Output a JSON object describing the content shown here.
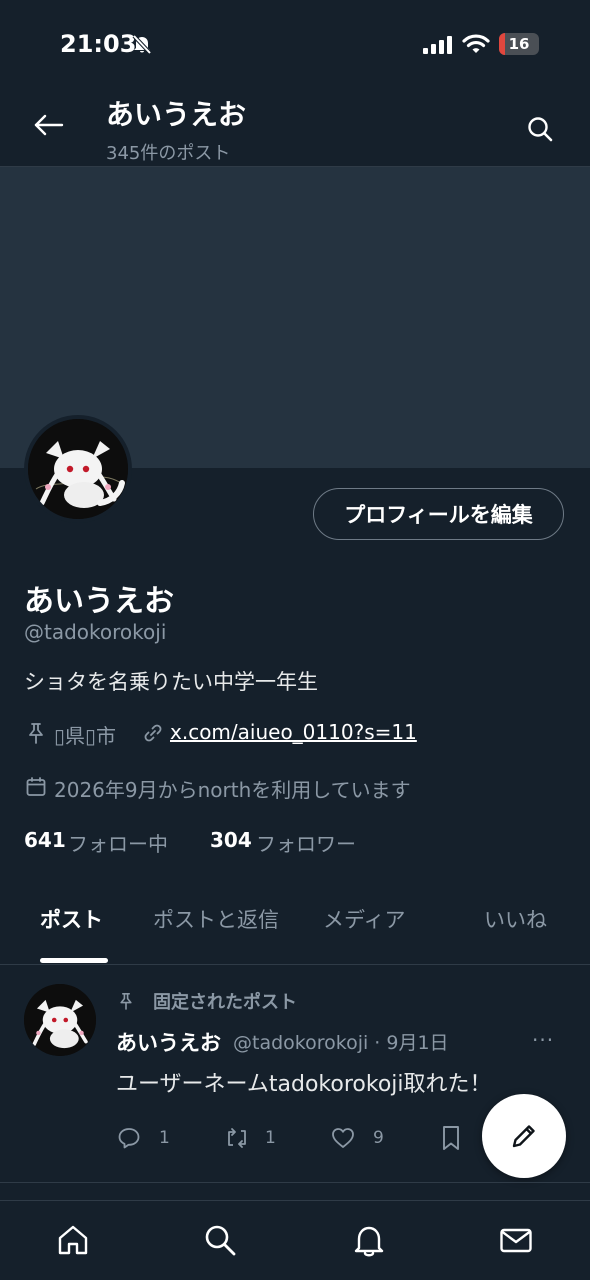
{
  "status_bar": {
    "time": "21:03",
    "battery": "16",
    "battery_level_pct": 16,
    "icons": [
      "bell-off-icon",
      "signal-icon",
      "wifi-icon",
      "battery-icon"
    ]
  },
  "header": {
    "title": "あいうえお",
    "post_count": "345件のポスト",
    "icons": [
      "back-arrow-icon",
      "search-icon"
    ]
  },
  "profile": {
    "edit_button": "プロフィールを編集",
    "name": "あいうえお",
    "handle": "@tadokorokoji",
    "bio": "ショタを名乗りたい中学一年生",
    "location": "▯県▯市",
    "link": "x.com/aiueo_0110?s=11",
    "joined": "2026年9月からnorthを利用しています",
    "following_count": "641",
    "following_label": "フォロー中",
    "followers_count": "304",
    "followers_label": "フォロワー"
  },
  "tabs": [
    {
      "label": "ポスト",
      "active": true
    },
    {
      "label": "ポストと返信",
      "active": false
    },
    {
      "label": "メディア",
      "active": false
    },
    {
      "label": "いいね",
      "active": false
    }
  ],
  "pinned_post": {
    "pinned_label": "固定されたポスト",
    "author_name": "あいうえお",
    "author_meta": "@tadokorokoji · 9月1日",
    "more": "···",
    "text": "ユーザーネームtadokorokoji取れた！",
    "replies": "1",
    "reposts": "1",
    "likes": "9"
  },
  "bottom_nav": {
    "items": [
      "home-icon",
      "search-icon",
      "bell-icon",
      "mail-icon"
    ]
  },
  "colors": {
    "background": "#15202b",
    "banner": "#253340",
    "text": "#e7e9ea",
    "muted": "#8b98a5",
    "battery_low": "#e0473e"
  }
}
